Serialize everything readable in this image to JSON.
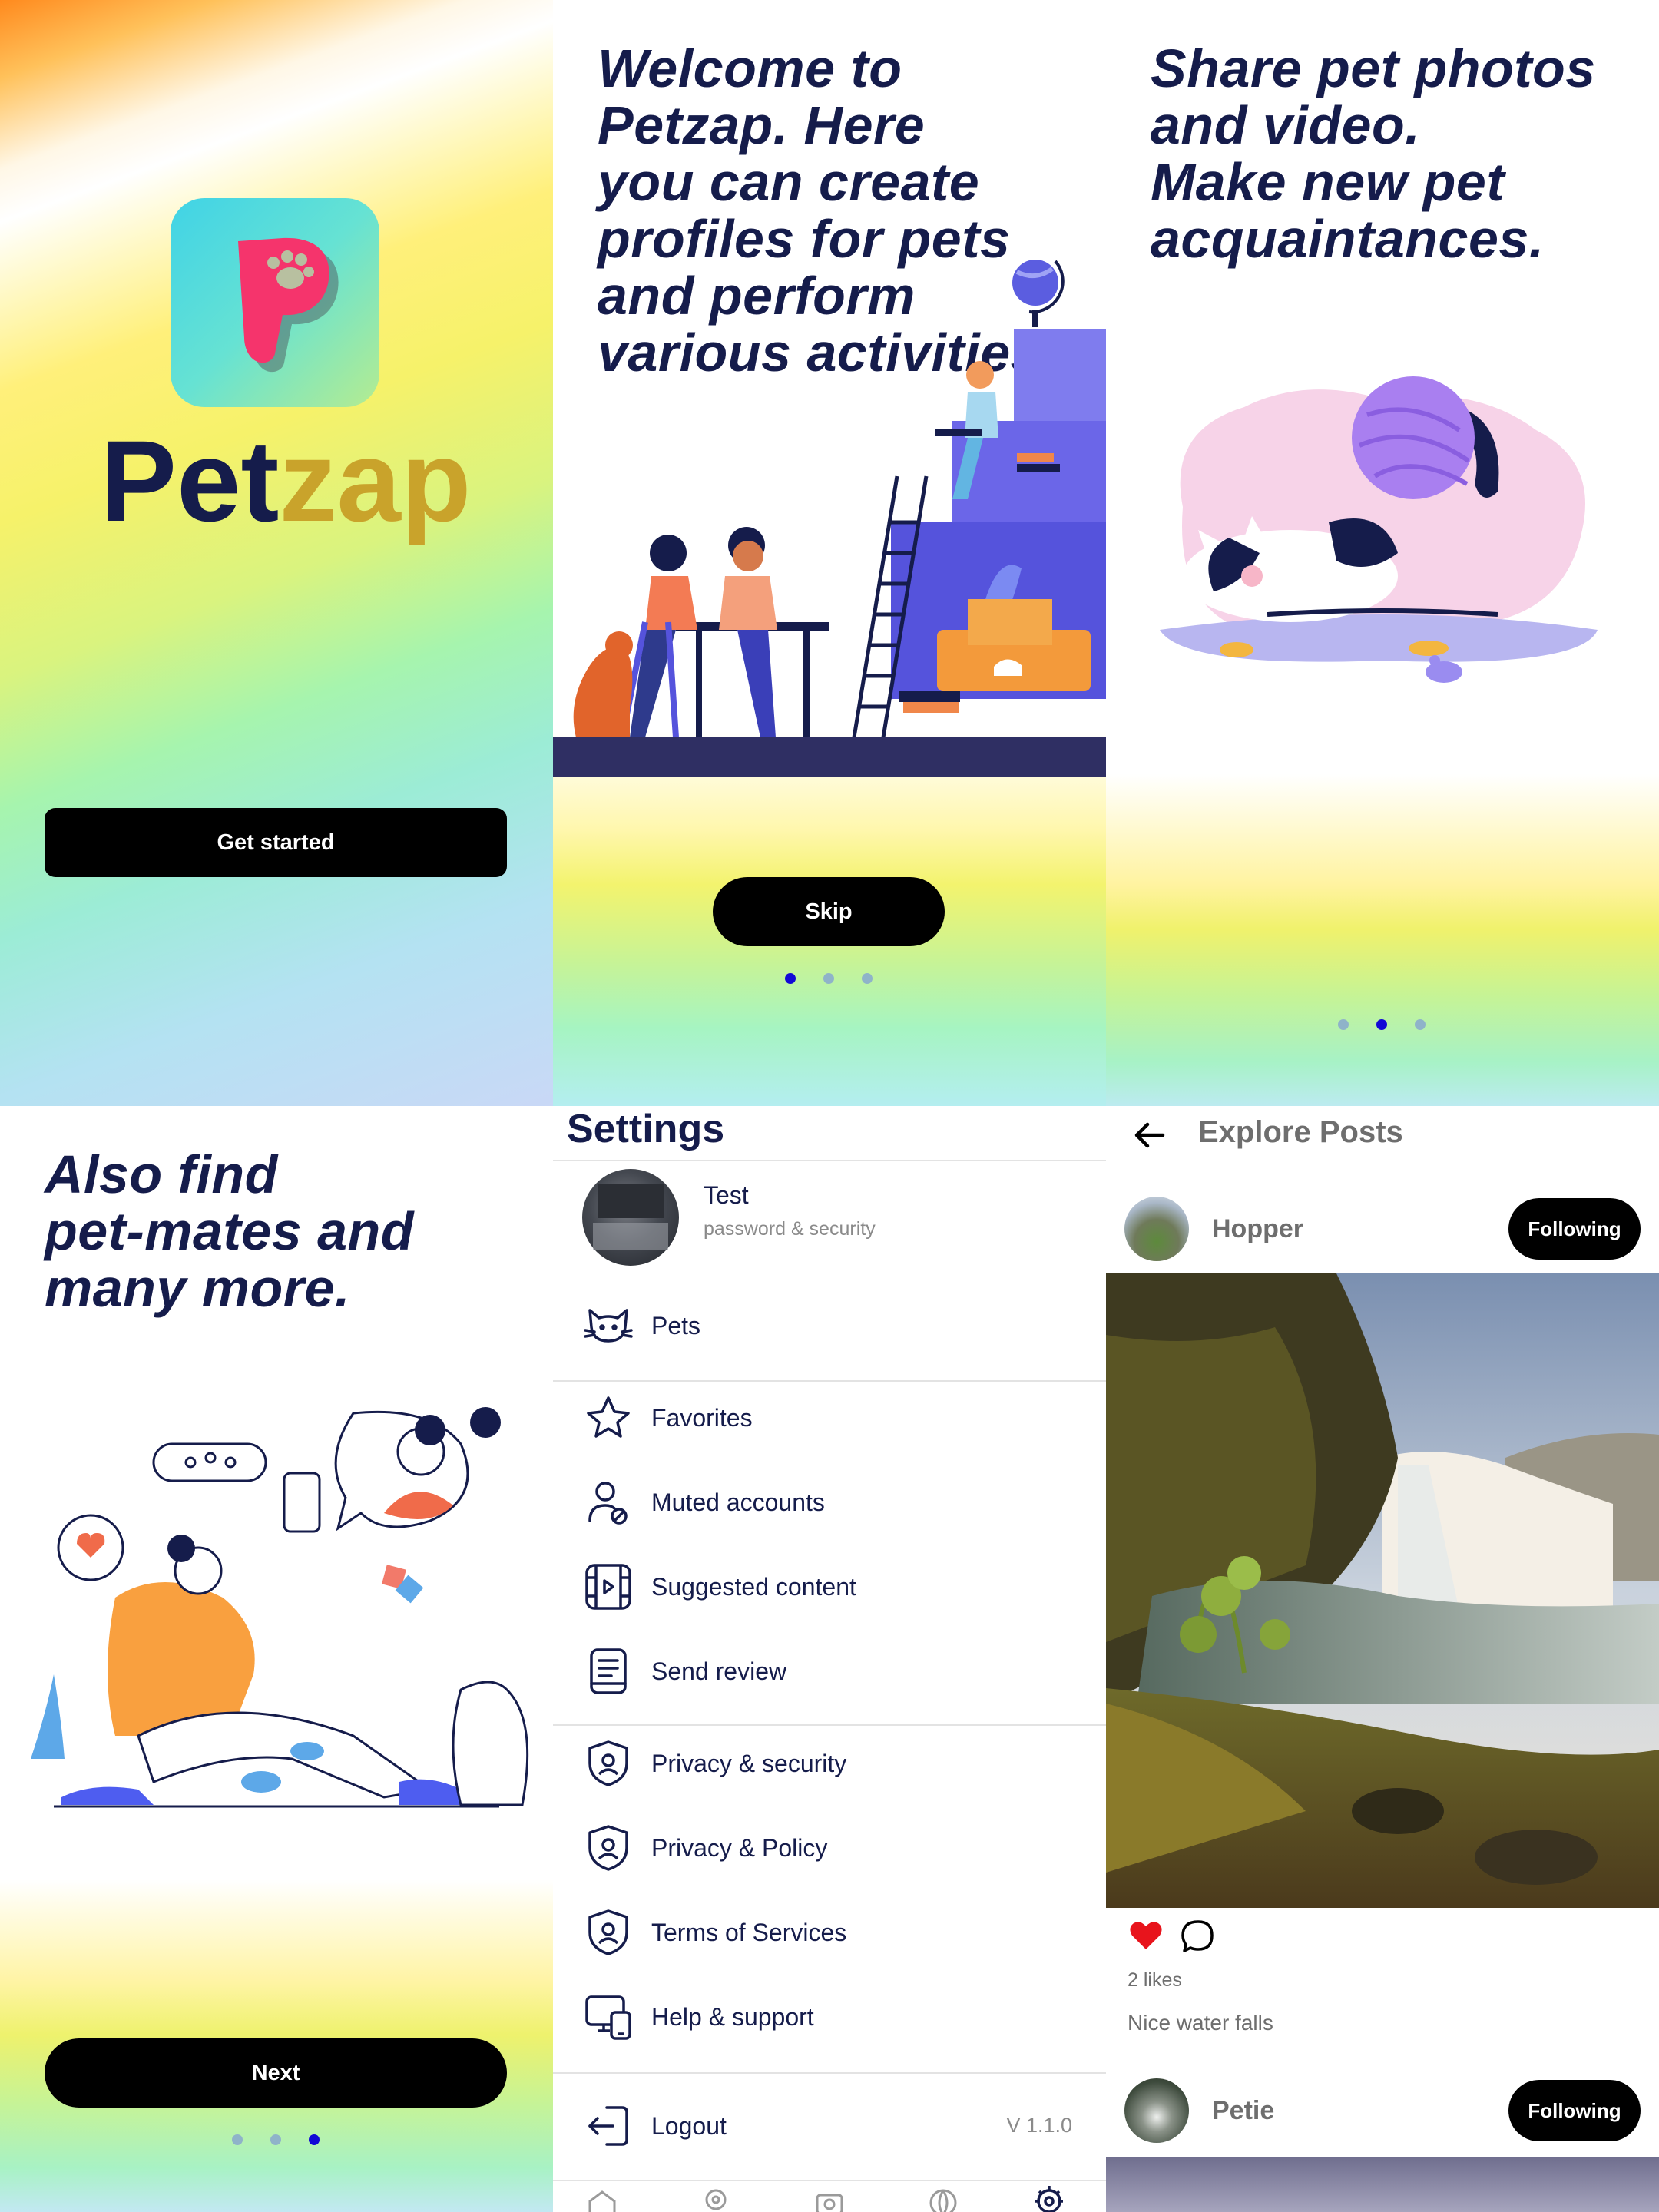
{
  "splash": {
    "brand_part1": "Pet",
    "brand_part2": "zap",
    "cta": "Get started"
  },
  "onboarding": {
    "slide1": {
      "headline_lines": [
        "Welcome to",
        "Petzap. Here",
        "you can create",
        "profiles for pets",
        "and perform",
        "various activities."
      ],
      "button": "Skip",
      "active_dot": 1
    },
    "slide2": {
      "headline_lines": [
        "Share pet photos",
        "and video.",
        "Make new pet",
        "acquaintances."
      ],
      "active_dot": 2
    },
    "slide3": {
      "headline_lines": [
        "Also find",
        "pet-mates and",
        "many more."
      ],
      "button": "Next",
      "active_dot": 3
    }
  },
  "settings": {
    "title": "Settings",
    "profile": {
      "name": "Test",
      "subtitle": "password & security"
    },
    "items": [
      {
        "label": "Pets",
        "icon": "cat-icon"
      },
      {
        "label": "Favorites",
        "icon": "star-icon"
      },
      {
        "label": "Muted accounts",
        "icon": "muted-user-icon"
      },
      {
        "label": "Suggested content",
        "icon": "film-icon"
      },
      {
        "label": "Send review",
        "icon": "document-icon"
      },
      {
        "label": "Privacy & security",
        "icon": "shield-user-icon"
      },
      {
        "label": "Privacy & Policy",
        "icon": "shield-user-icon"
      },
      {
        "label": "Terms of Services",
        "icon": "shield-user-icon"
      },
      {
        "label": "Help & support",
        "icon": "devices-icon"
      }
    ],
    "logout": "Logout",
    "version": "V 1.1.0"
  },
  "explore": {
    "title": "Explore Posts",
    "posts": [
      {
        "user": "Hopper",
        "follow_label": "Following",
        "likes": "2 likes",
        "caption": "Nice water falls",
        "liked": true
      },
      {
        "user": "Petie",
        "follow_label": "Following"
      }
    ]
  },
  "colors": {
    "navy": "#151c4b",
    "accent_gold": "#c9a32b",
    "active_dot": "#1208d6",
    "like_red": "#e8141c"
  }
}
